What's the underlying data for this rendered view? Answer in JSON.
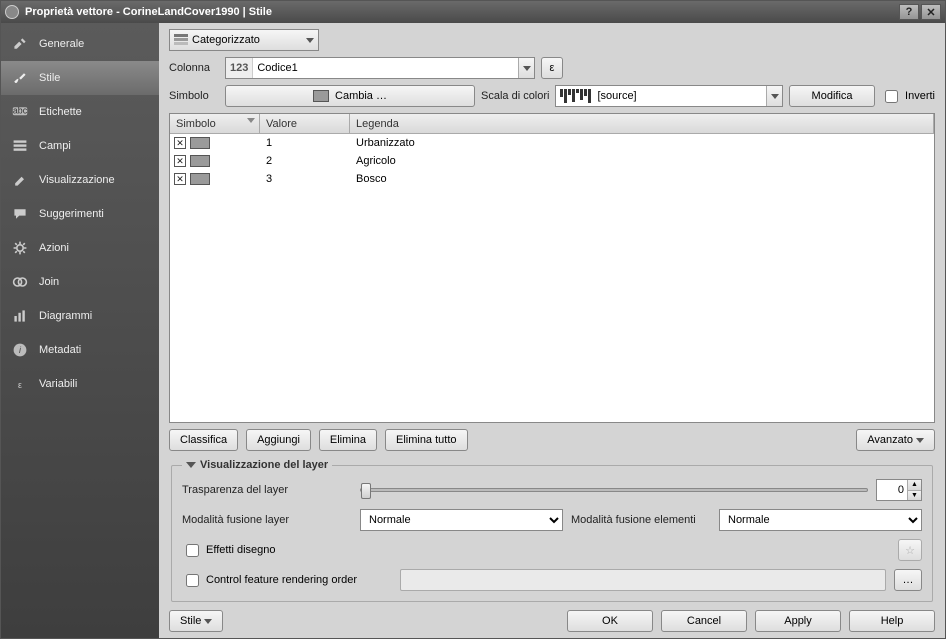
{
  "window": {
    "title": "Proprietà vettore - CorineLandCover1990 | Stile"
  },
  "sidebar": {
    "items": [
      {
        "label": "Generale"
      },
      {
        "label": "Stile"
      },
      {
        "label": "Etichette"
      },
      {
        "label": "Campi"
      },
      {
        "label": "Visualizzazione"
      },
      {
        "label": "Suggerimenti"
      },
      {
        "label": "Azioni"
      },
      {
        "label": "Join"
      },
      {
        "label": "Diagrammi"
      },
      {
        "label": "Metadati"
      },
      {
        "label": "Variabili"
      }
    ],
    "selected_index": 1
  },
  "renderer": {
    "type": "Categorizzato"
  },
  "column": {
    "label": "Colonna",
    "prefix": "123",
    "value": "Codice1",
    "epsilon_label": "ε"
  },
  "symbol": {
    "label": "Simbolo",
    "change_label": "Cambia …"
  },
  "ramp": {
    "label": "Scala di colori",
    "value": "[source]",
    "modify_label": "Modifica",
    "invert_label": "Inverti"
  },
  "table": {
    "headers": {
      "symbol": "Simbolo",
      "value": "Valore",
      "legend": "Legenda"
    },
    "rows": [
      {
        "value": "1",
        "legend": "Urbanizzato"
      },
      {
        "value": "2",
        "legend": "Agricolo"
      },
      {
        "value": "3",
        "legend": "Bosco"
      }
    ]
  },
  "classify": {
    "classify": "Classifica",
    "add": "Aggiungi",
    "delete": "Elimina",
    "delete_all": "Elimina tutto",
    "advanced": "Avanzato"
  },
  "layer_vis": {
    "title": "Visualizzazione del layer",
    "transparency_label": "Trasparenza del layer",
    "transparency_value": "0",
    "blend_layer_label": "Modalità fusione layer",
    "blend_layer_value": "Normale",
    "blend_feature_label": "Modalità fusione elementi",
    "blend_feature_value": "Normale",
    "draw_effects": "Effetti disegno",
    "control_order": "Control feature rendering order"
  },
  "footer": {
    "style": "Stile",
    "ok": "OK",
    "cancel": "Cancel",
    "apply": "Apply",
    "help": "Help"
  }
}
